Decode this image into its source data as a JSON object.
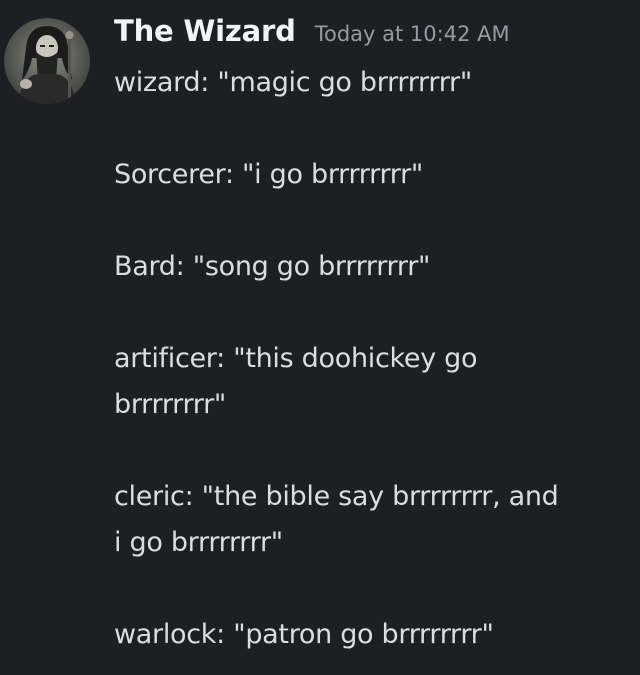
{
  "message": {
    "author": "The Wizard",
    "timestamp": "Today at 10:42 AM",
    "avatar_icon": "wizard-avatar-icon",
    "lines": [
      "wizard: \"magic go brrrrrrrr\"",
      "",
      "Sorcerer: \"i go brrrrrrrr\"",
      "",
      "Bard: \"song go brrrrrrrr\"",
      "",
      "artificer: \"this doohickey go",
      "brrrrrrrr\"",
      "",
      "cleric: \"the bible say brrrrrrrr, and",
      "i go brrrrrrrr\"",
      "",
      "warlock: \"patron go brrrrrrrr\""
    ]
  },
  "colors": {
    "background": "#1e1f23",
    "author": "#f2f3f5",
    "timestamp": "#949ba4",
    "text": "#dbdee1"
  }
}
